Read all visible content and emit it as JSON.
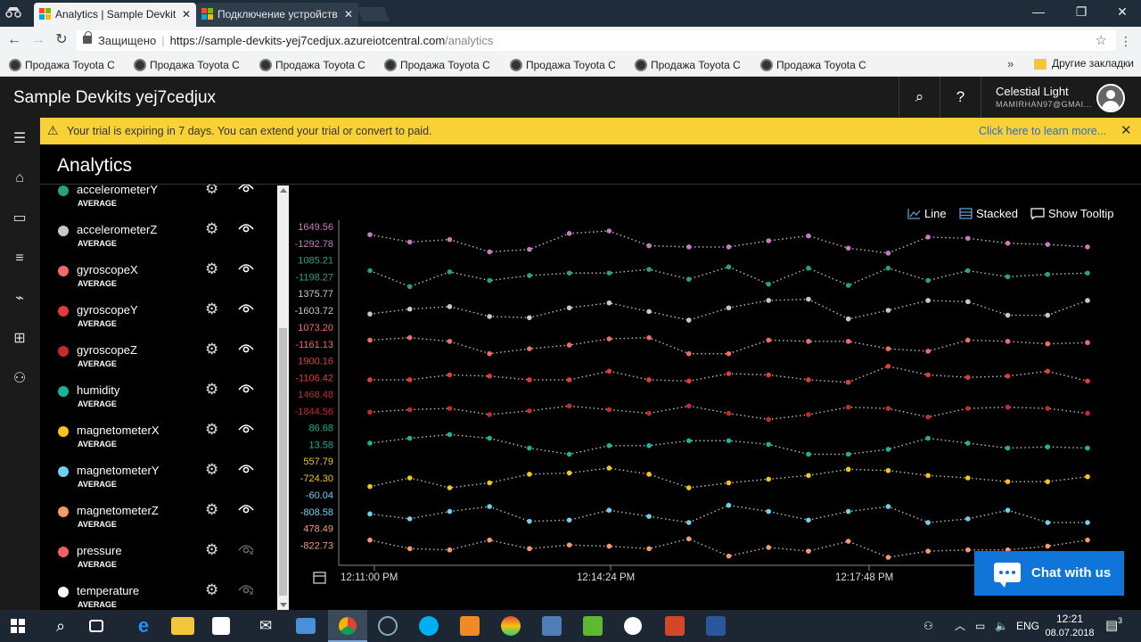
{
  "browser": {
    "tabs": [
      {
        "title": "Analytics | Sample Devkit",
        "active": true
      },
      {
        "title": "Подключение устройств",
        "active": false
      }
    ],
    "security_label": "Защищено",
    "url_host": "https://sample-devkits-yej7cedjux.azureiotcentral.com",
    "url_path": "/analytics",
    "bookmarks": [
      "Продажа Toyota Co",
      "Продажа Toyota Co",
      "Продажа Toyota Co",
      "Продажа Toyota Co",
      "Продажа Toyota Co",
      "Продажа Toyota Co",
      "Продажа Toyota Co"
    ],
    "more_bookmarks": "»",
    "other_bookmarks": "Другие закладки"
  },
  "app": {
    "title": "Sample Devkits yej7cedjux",
    "user_name": "Celestial Light",
    "user_email": "MAMIRHAN97@GMAI..."
  },
  "banner": {
    "message": "Your trial is expiring in 7 days. You can extend your trial or convert to paid.",
    "link": "Click here to learn more..."
  },
  "page": {
    "title": "Analytics"
  },
  "measures": [
    {
      "name": "accelerometerY",
      "agg": "AVERAGE",
      "color": "#26a37f",
      "visible": true
    },
    {
      "name": "accelerometerZ",
      "agg": "AVERAGE",
      "color": "#c8c8c8",
      "visible": true
    },
    {
      "name": "gyroscopeX",
      "agg": "AVERAGE",
      "color": "#f06b6b",
      "visible": true
    },
    {
      "name": "gyroscopeY",
      "agg": "AVERAGE",
      "color": "#e53a3a",
      "visible": true
    },
    {
      "name": "gyroscopeZ",
      "agg": "AVERAGE",
      "color": "#c42b2b",
      "visible": true
    },
    {
      "name": "humidity",
      "agg": "AVERAGE",
      "color": "#1ab39b",
      "visible": true
    },
    {
      "name": "magnetometerX",
      "agg": "AVERAGE",
      "color": "#f5c518",
      "visible": true
    },
    {
      "name": "magnetometerY",
      "agg": "AVERAGE",
      "color": "#6fd0f0",
      "visible": true
    },
    {
      "name": "magnetometerZ",
      "agg": "AVERAGE",
      "color": "#f59a6b",
      "visible": true
    },
    {
      "name": "pressure",
      "agg": "AVERAGE",
      "color": "#f06060",
      "visible": false
    },
    {
      "name": "temperature",
      "agg": "AVERAGE",
      "color": "#ffffff",
      "visible": false
    }
  ],
  "chart_options": {
    "line": "Line",
    "stacked": "Stacked",
    "tooltip": "Show Tooltip"
  },
  "chat_button": "Chat with us",
  "chart_data": {
    "type": "line",
    "stacked": true,
    "x_ticks": [
      "12:11:00 PM",
      "12:14:24 PM",
      "12:17:48 PM"
    ],
    "series": [
      {
        "name": "",
        "color": "#c879c0",
        "range": [
          "1649.56",
          "-1292.78"
        ],
        "values": [
          0.85,
          0.55,
          0.65,
          0.15,
          0.25,
          0.9,
          1.0,
          0.4,
          0.35,
          0.35,
          0.6,
          0.8,
          0.3,
          0.1,
          0.75,
          0.7,
          0.5,
          0.45,
          0.35
        ]
      },
      {
        "name": "",
        "color": "#26a37f",
        "range": [
          "1085.21",
          "-1198.27"
        ],
        "values": [
          0.75,
          0.1,
          0.7,
          0.35,
          0.55,
          0.65,
          0.65,
          0.8,
          0.4,
          0.9,
          0.2,
          0.85,
          0.15,
          0.85,
          0.35,
          0.75,
          0.5,
          0.6,
          0.65
        ]
      },
      {
        "name": "",
        "color": "#c8c8c8",
        "range": [
          "1375.77",
          "-1603.72"
        ],
        "values": [
          0.35,
          0.55,
          0.65,
          0.25,
          0.2,
          0.6,
          0.8,
          0.45,
          0.1,
          0.6,
          0.9,
          0.95,
          0.15,
          0.5,
          0.9,
          0.85,
          0.3,
          0.3,
          0.9
        ]
      },
      {
        "name": "",
        "color": "#f06b6b",
        "range": [
          "1073.20",
          "-1161.13"
        ],
        "values": [
          0.65,
          0.75,
          0.6,
          0.1,
          0.3,
          0.45,
          0.7,
          0.75,
          0.1,
          0.1,
          0.65,
          0.6,
          0.6,
          0.3,
          0.2,
          0.65,
          0.6,
          0.5,
          0.55
        ]
      },
      {
        "name": "",
        "color": "#e53a3a",
        "range": [
          "1900.16",
          "-1106.42"
        ],
        "values": [
          0.4,
          0.4,
          0.6,
          0.55,
          0.4,
          0.4,
          0.75,
          0.4,
          0.35,
          0.65,
          0.6,
          0.4,
          0.3,
          0.95,
          0.6,
          0.5,
          0.55,
          0.75,
          0.35
        ]
      },
      {
        "name": "",
        "color": "#c42b2b",
        "range": [
          "1468.48",
          "-1844.56"
        ],
        "values": [
          0.45,
          0.55,
          0.6,
          0.35,
          0.5,
          0.7,
          0.55,
          0.4,
          0.7,
          0.4,
          0.15,
          0.35,
          0.65,
          0.6,
          0.25,
          0.6,
          0.65,
          0.6,
          0.4
        ]
      },
      {
        "name": "",
        "color": "#1ab39b",
        "range": [
          "86.68",
          "13.58"
        ],
        "values": [
          0.55,
          0.75,
          0.9,
          0.75,
          0.35,
          0.1,
          0.45,
          0.45,
          0.65,
          0.65,
          0.5,
          0.1,
          0.1,
          0.3,
          0.75,
          0.55,
          0.35,
          0.4,
          0.35
        ]
      },
      {
        "name": "",
        "color": "#f5c518",
        "range": [
          "557.79",
          "-724.30"
        ],
        "values": [
          0.15,
          0.5,
          0.1,
          0.3,
          0.65,
          0.7,
          0.9,
          0.65,
          0.1,
          0.3,
          0.45,
          0.6,
          0.85,
          0.8,
          0.6,
          0.5,
          0.35,
          0.35,
          0.55
        ]
      },
      {
        "name": "",
        "color": "#6fd0f0",
        "range": [
          "-60.04",
          "-808.58"
        ],
        "values": [
          0.4,
          0.2,
          0.5,
          0.7,
          0.1,
          0.15,
          0.55,
          0.3,
          0.05,
          0.75,
          0.5,
          0.15,
          0.5,
          0.7,
          0.05,
          0.2,
          0.55,
          0.05,
          0.05
        ]
      },
      {
        "name": "",
        "color": "#f59a6b",
        "range": [
          "478.49",
          "-822.73"
        ],
        "values": [
          0.7,
          0.35,
          0.3,
          0.7,
          0.35,
          0.5,
          0.45,
          0.35,
          0.75,
          0.05,
          0.4,
          0.25,
          0.65,
          0.0,
          0.25,
          0.3,
          0.3,
          0.45,
          0.7
        ]
      }
    ]
  },
  "taskbar": {
    "lang": "ENG",
    "time": "12:21",
    "date": "08.07.2018",
    "notif_count": "3"
  }
}
